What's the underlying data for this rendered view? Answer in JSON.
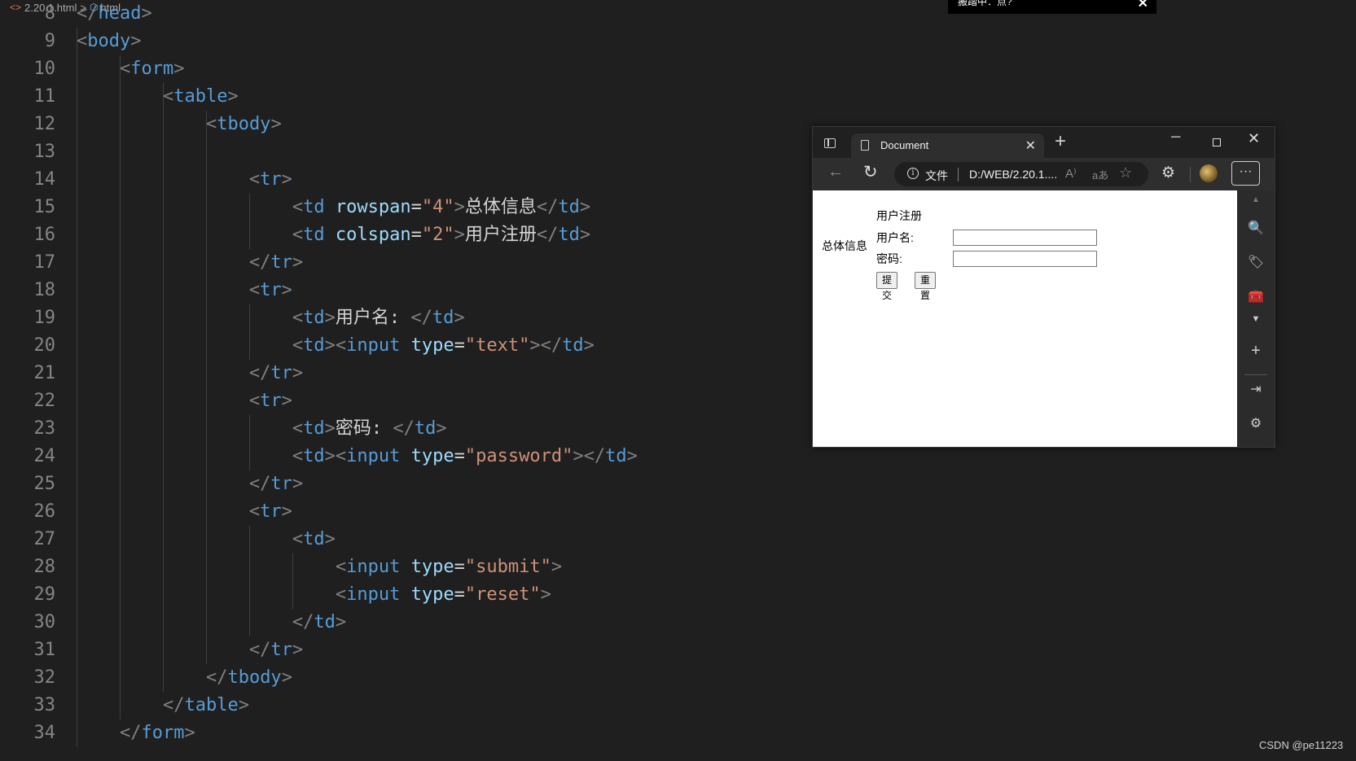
{
  "breadcrumb": {
    "file": "2.20.1.html",
    "separator": ">",
    "element": "html"
  },
  "ime": {
    "text": "搬踏中：点?",
    "close": "✕"
  },
  "editor": {
    "lines": [
      {
        "n": "8",
        "parts": [
          [
            "punct",
            "</"
          ],
          [
            "tag",
            "head"
          ],
          [
            "punct",
            ">"
          ]
        ]
      },
      {
        "n": "9",
        "parts": [
          [
            "punct",
            "<"
          ],
          [
            "tag",
            "body"
          ],
          [
            "punct",
            ">"
          ]
        ]
      },
      {
        "n": "10",
        "parts": [
          [
            "txt",
            "    "
          ],
          [
            "punct",
            "<"
          ],
          [
            "tag",
            "form"
          ],
          [
            "punct",
            ">"
          ]
        ]
      },
      {
        "n": "11",
        "parts": [
          [
            "txt",
            "        "
          ],
          [
            "punct",
            "<"
          ],
          [
            "tag",
            "table"
          ],
          [
            "punct",
            ">"
          ]
        ]
      },
      {
        "n": "12",
        "parts": [
          [
            "txt",
            "            "
          ],
          [
            "punct",
            "<"
          ],
          [
            "tag",
            "tbody"
          ],
          [
            "punct",
            ">"
          ]
        ]
      },
      {
        "n": "13",
        "parts": []
      },
      {
        "n": "14",
        "parts": [
          [
            "txt",
            "                "
          ],
          [
            "punct",
            "<"
          ],
          [
            "tag",
            "tr"
          ],
          [
            "punct",
            ">"
          ]
        ]
      },
      {
        "n": "15",
        "parts": [
          [
            "txt",
            "                    "
          ],
          [
            "punct",
            "<"
          ],
          [
            "tag",
            "td"
          ],
          [
            "txt",
            " "
          ],
          [
            "attr",
            "rowspan"
          ],
          [
            "txt",
            "="
          ],
          [
            "str",
            "\"4\""
          ],
          [
            "punct",
            ">"
          ],
          [
            "txt",
            "总体信息"
          ],
          [
            "punct",
            "</"
          ],
          [
            "tag",
            "td"
          ],
          [
            "punct",
            ">"
          ]
        ]
      },
      {
        "n": "16",
        "parts": [
          [
            "txt",
            "                    "
          ],
          [
            "punct",
            "<"
          ],
          [
            "tag",
            "td"
          ],
          [
            "txt",
            " "
          ],
          [
            "attr",
            "colspan"
          ],
          [
            "txt",
            "="
          ],
          [
            "str",
            "\"2\""
          ],
          [
            "punct",
            ">"
          ],
          [
            "txt",
            "用户注册"
          ],
          [
            "punct",
            "</"
          ],
          [
            "tag",
            "td"
          ],
          [
            "punct",
            ">"
          ]
        ]
      },
      {
        "n": "17",
        "parts": [
          [
            "txt",
            "                "
          ],
          [
            "punct",
            "</"
          ],
          [
            "tag",
            "tr"
          ],
          [
            "punct",
            ">"
          ]
        ]
      },
      {
        "n": "18",
        "parts": [
          [
            "txt",
            "                "
          ],
          [
            "punct",
            "<"
          ],
          [
            "tag",
            "tr"
          ],
          [
            "punct",
            ">"
          ]
        ]
      },
      {
        "n": "19",
        "parts": [
          [
            "txt",
            "                    "
          ],
          [
            "punct",
            "<"
          ],
          [
            "tag",
            "td"
          ],
          [
            "punct",
            ">"
          ],
          [
            "txt",
            "用户名: "
          ],
          [
            "punct",
            "</"
          ],
          [
            "tag",
            "td"
          ],
          [
            "punct",
            ">"
          ]
        ]
      },
      {
        "n": "20",
        "parts": [
          [
            "txt",
            "                    "
          ],
          [
            "punct",
            "<"
          ],
          [
            "tag",
            "td"
          ],
          [
            "punct",
            "><"
          ],
          [
            "tag",
            "input"
          ],
          [
            "txt",
            " "
          ],
          [
            "attr",
            "type"
          ],
          [
            "txt",
            "="
          ],
          [
            "str",
            "\"text\""
          ],
          [
            "punct",
            "></"
          ],
          [
            "tag",
            "td"
          ],
          [
            "punct",
            ">"
          ]
        ]
      },
      {
        "n": "21",
        "parts": [
          [
            "txt",
            "                "
          ],
          [
            "punct",
            "</"
          ],
          [
            "tag",
            "tr"
          ],
          [
            "punct",
            ">"
          ]
        ]
      },
      {
        "n": "22",
        "parts": [
          [
            "txt",
            "                "
          ],
          [
            "punct",
            "<"
          ],
          [
            "tag",
            "tr"
          ],
          [
            "punct",
            ">"
          ]
        ]
      },
      {
        "n": "23",
        "parts": [
          [
            "txt",
            "                    "
          ],
          [
            "punct",
            "<"
          ],
          [
            "tag",
            "td"
          ],
          [
            "punct",
            ">"
          ],
          [
            "txt",
            "密码: "
          ],
          [
            "punct",
            "</"
          ],
          [
            "tag",
            "td"
          ],
          [
            "punct",
            ">"
          ]
        ]
      },
      {
        "n": "24",
        "parts": [
          [
            "txt",
            "                    "
          ],
          [
            "punct",
            "<"
          ],
          [
            "tag",
            "td"
          ],
          [
            "punct",
            "><"
          ],
          [
            "tag",
            "input"
          ],
          [
            "txt",
            " "
          ],
          [
            "attr",
            "type"
          ],
          [
            "txt",
            "="
          ],
          [
            "str",
            "\"password\""
          ],
          [
            "punct",
            "></"
          ],
          [
            "tag",
            "td"
          ],
          [
            "punct",
            ">"
          ]
        ]
      },
      {
        "n": "25",
        "parts": [
          [
            "txt",
            "                "
          ],
          [
            "punct",
            "</"
          ],
          [
            "tag",
            "tr"
          ],
          [
            "punct",
            ">"
          ]
        ]
      },
      {
        "n": "26",
        "parts": [
          [
            "txt",
            "                "
          ],
          [
            "punct",
            "<"
          ],
          [
            "tag",
            "tr"
          ],
          [
            "punct",
            ">"
          ]
        ]
      },
      {
        "n": "27",
        "parts": [
          [
            "txt",
            "                    "
          ],
          [
            "punct",
            "<"
          ],
          [
            "tag",
            "td"
          ],
          [
            "punct",
            ">"
          ]
        ]
      },
      {
        "n": "28",
        "parts": [
          [
            "txt",
            "                        "
          ],
          [
            "punct",
            "<"
          ],
          [
            "tag",
            "input"
          ],
          [
            "txt",
            " "
          ],
          [
            "attr",
            "type"
          ],
          [
            "txt",
            "="
          ],
          [
            "str",
            "\"submit\""
          ],
          [
            "punct",
            ">"
          ]
        ]
      },
      {
        "n": "29",
        "parts": [
          [
            "txt",
            "                        "
          ],
          [
            "punct",
            "<"
          ],
          [
            "tag",
            "input"
          ],
          [
            "txt",
            " "
          ],
          [
            "attr",
            "type"
          ],
          [
            "txt",
            "="
          ],
          [
            "str",
            "\"reset\""
          ],
          [
            "punct",
            ">"
          ]
        ]
      },
      {
        "n": "30",
        "parts": [
          [
            "txt",
            "                    "
          ],
          [
            "punct",
            "</"
          ],
          [
            "tag",
            "td"
          ],
          [
            "punct",
            ">"
          ]
        ]
      },
      {
        "n": "31",
        "parts": [
          [
            "txt",
            "                "
          ],
          [
            "punct",
            "</"
          ],
          [
            "tag",
            "tr"
          ],
          [
            "punct",
            ">"
          ]
        ]
      },
      {
        "n": "32",
        "parts": [
          [
            "txt",
            "            "
          ],
          [
            "punct",
            "</"
          ],
          [
            "tag",
            "tbody"
          ],
          [
            "punct",
            ">"
          ]
        ]
      },
      {
        "n": "33",
        "parts": [
          [
            "txt",
            "        "
          ],
          [
            "punct",
            "</"
          ],
          [
            "tag",
            "table"
          ],
          [
            "punct",
            ">"
          ]
        ]
      },
      {
        "n": "34",
        "parts": [
          [
            "txt",
            "    "
          ],
          [
            "punct",
            "</"
          ],
          [
            "tag",
            "form"
          ],
          [
            "punct",
            ">"
          ]
        ]
      }
    ]
  },
  "browser": {
    "tab_title": "Document",
    "tab_close": "✕",
    "new_tab": "+",
    "minimize": "─",
    "close": "✕",
    "back": "←",
    "refresh": "↻",
    "info_glyph": "i",
    "file_label": "文件",
    "url": "D:/WEB/2.20.1....",
    "read_aloud": "A⁾",
    "translate": "aあ",
    "favorite": "☆",
    "extensions": "⚙",
    "more": "···",
    "sidebar_icons": [
      "▲",
      "🔍",
      "🏷",
      "🧰",
      "▼",
      "+",
      "⇥",
      "⚙"
    ],
    "page": {
      "overall_info": "总体信息",
      "user_register": "用户注册",
      "username_label": "用户名:",
      "password_label": "密码:",
      "username_value": "",
      "password_value": "",
      "submit_label": "提交",
      "reset_label": "重置"
    }
  },
  "watermark": "CSDN @pe11223"
}
